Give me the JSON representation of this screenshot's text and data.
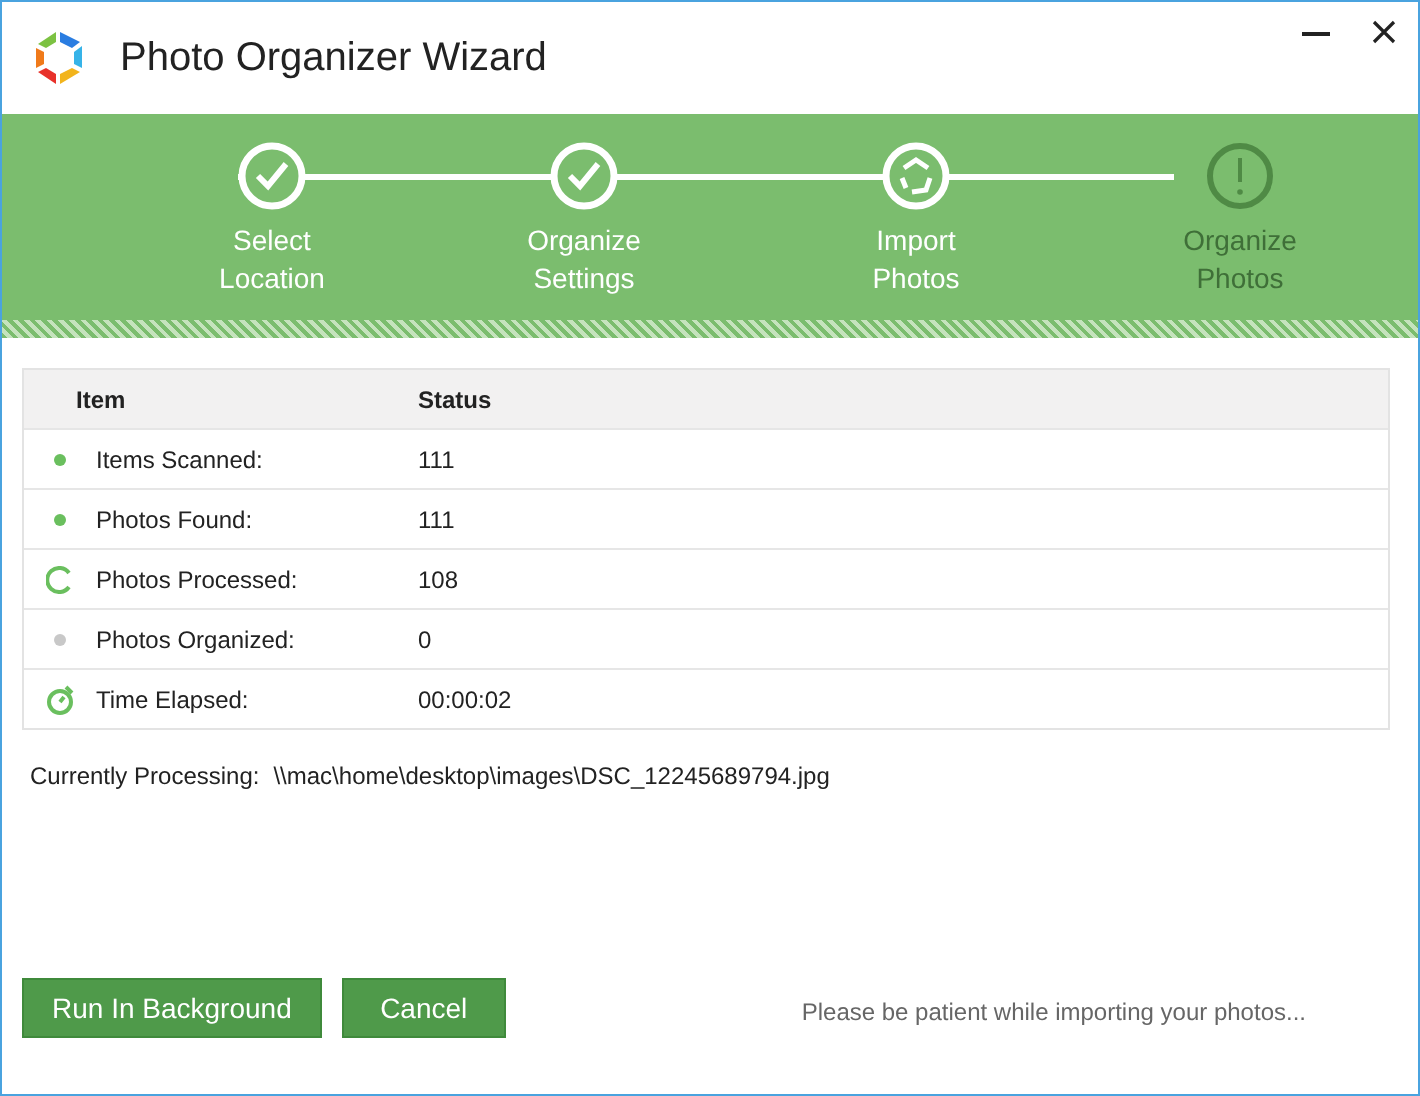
{
  "window": {
    "title": "Photo Organizer Wizard"
  },
  "steps": [
    {
      "label": "Select Location",
      "kind": "done"
    },
    {
      "label": "Organize Settings",
      "kind": "done"
    },
    {
      "label": "Import Photos",
      "kind": "active"
    },
    {
      "label": "Organize Photos",
      "kind": "pending"
    }
  ],
  "table": {
    "columns": [
      "Item",
      "Status"
    ],
    "rows": [
      {
        "item": "Items Scanned:",
        "status": "111",
        "kind": "done"
      },
      {
        "item": "Photos Found:",
        "status": "111",
        "kind": "done"
      },
      {
        "item": "Photos Processed:",
        "status": "108",
        "kind": "progress"
      },
      {
        "item": "Photos Organized:",
        "status": "0",
        "kind": "pending"
      },
      {
        "item": "Time Elapsed:",
        "status": "00:00:02",
        "kind": "timer"
      }
    ]
  },
  "current": {
    "label": "Currently Processing:",
    "path": "\\\\mac\\home\\desktop\\images\\DSC_12245689794.jpg"
  },
  "buttons": [
    "Run In Background",
    "Cancel"
  ],
  "status_text": "Please be patient while importing your photos..."
}
